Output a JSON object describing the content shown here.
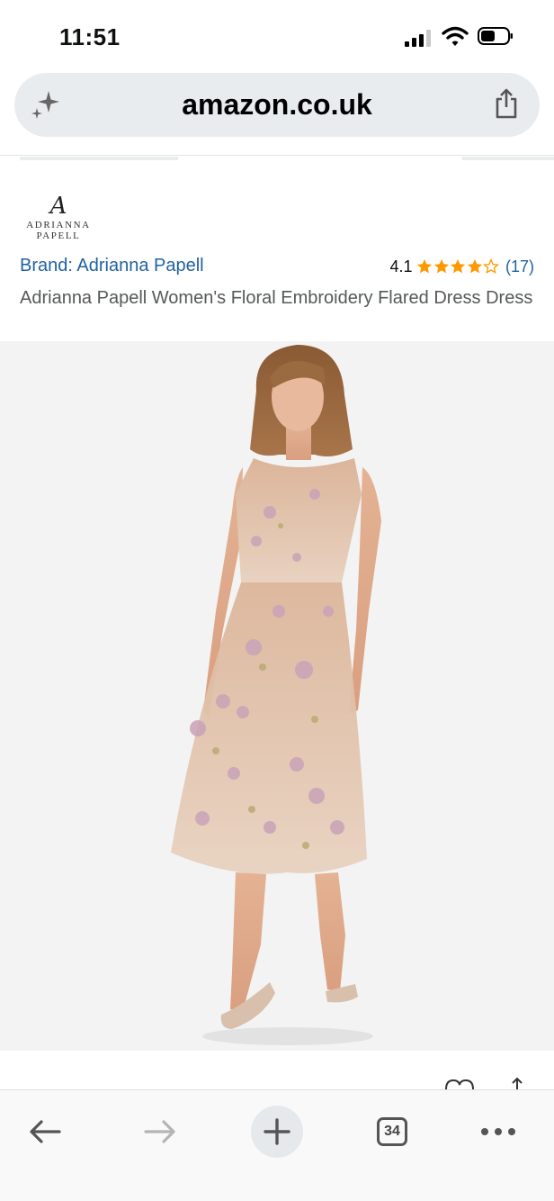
{
  "status_bar": {
    "time": "11:51"
  },
  "address_bar": {
    "url": "amazon.co.uk"
  },
  "brand": {
    "logo_monogram": "A",
    "logo_line1": "ADRIANNA",
    "logo_line2": "PAPELL",
    "link_label": "Brand: Adrianna Papell"
  },
  "rating": {
    "value": "4.1",
    "stars": 4.1,
    "count": "(17)",
    "star_color": "#ff9900"
  },
  "product": {
    "title": "Adrianna Papell Women's Floral Embroidery Flared Dress Dress"
  },
  "toolbar": {
    "tab_count": "34"
  },
  "colors": {
    "link": "#2162a1",
    "title_text": "#565959",
    "address_bg": "#e9ecef"
  },
  "icons": [
    "sparkle-icon",
    "share-icon",
    "back-arrow-icon",
    "forward-arrow-icon",
    "plus-icon",
    "tabs-icon",
    "more-icon"
  ]
}
